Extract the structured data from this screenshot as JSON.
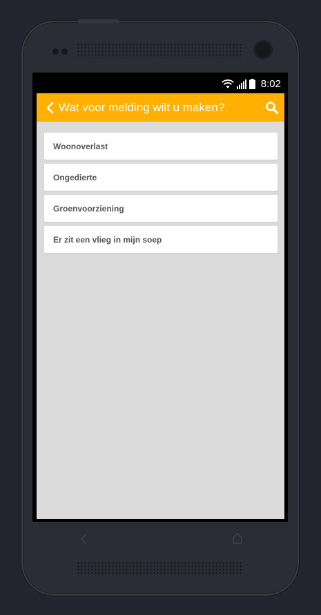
{
  "status_bar": {
    "time": "8:02",
    "icons": [
      "wifi-icon",
      "signal-icon",
      "battery-icon"
    ]
  },
  "app_bar": {
    "title": "Wat voor melding wilt u maken?",
    "back_icon": "chevron-left-icon",
    "search_icon": "search-icon",
    "color": "#ffb000"
  },
  "list": {
    "items": [
      {
        "label": "Woonoverlast"
      },
      {
        "label": "Ongedierte"
      },
      {
        "label": "Groenvoorziening"
      },
      {
        "label": "Er zit een vlieg in mijn soep"
      }
    ]
  },
  "device": {
    "nav_icons": [
      "back-nav-icon",
      "home-nav-icon"
    ]
  }
}
